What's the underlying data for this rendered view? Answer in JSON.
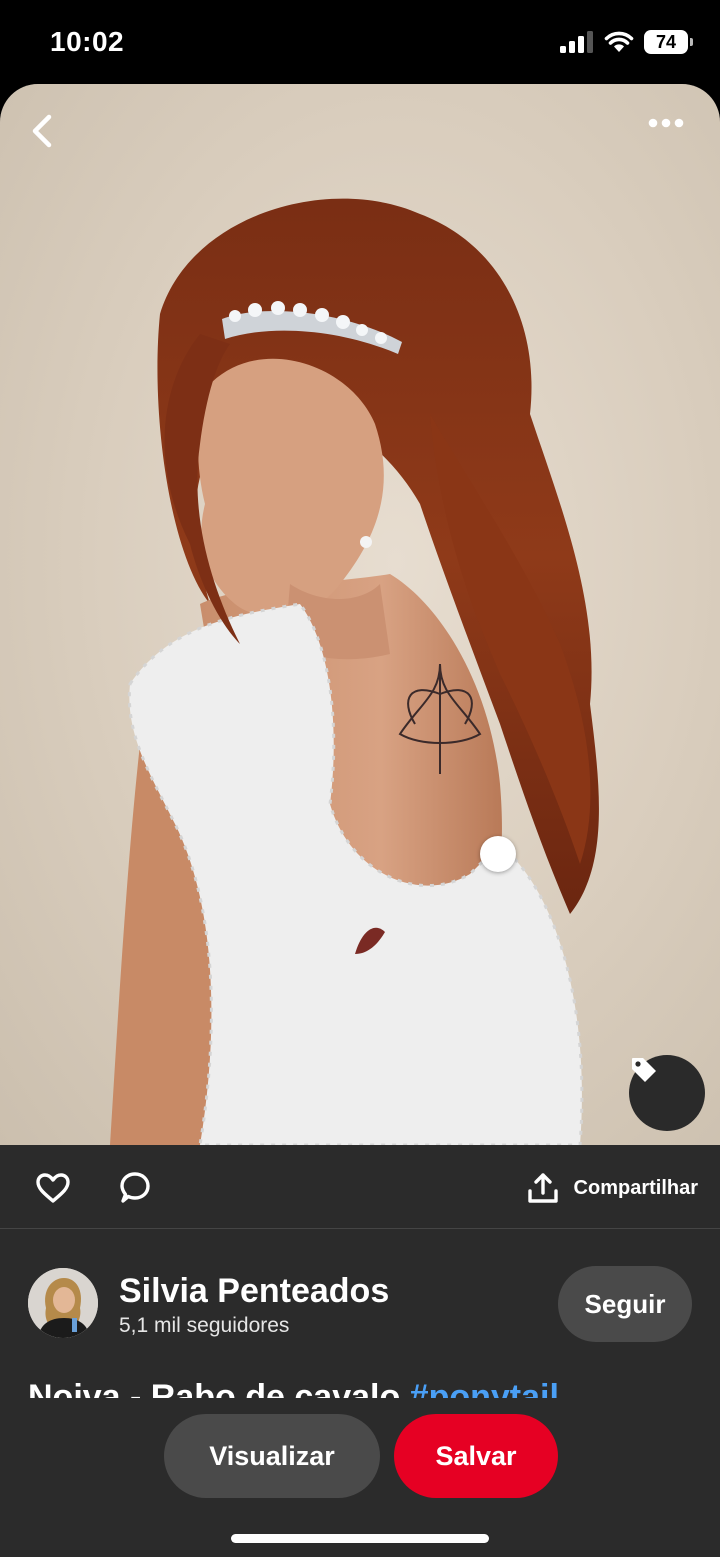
{
  "status_bar": {
    "time": "10:02",
    "battery": "74"
  },
  "pin": {
    "image_alt": "Noiva com vestido de renda e rabo de cavalo",
    "icons": {
      "back": "chevron-left-icon",
      "more": "more-horizontal-icon",
      "tag": "tag-icon"
    }
  },
  "actions": {
    "share_label": "Compartilhar",
    "icons": {
      "like": "heart-icon",
      "comment": "comment-icon",
      "share": "share-icon"
    }
  },
  "profile": {
    "name": "Silvia Penteados",
    "followers": "5,1 mil seguidores",
    "follow_label": "Seguir"
  },
  "description": {
    "text": "Noiva - Rabo de cavalo ",
    "hashtag": "#ponytail"
  },
  "bottom_bar": {
    "view_label": "Visualizar",
    "save_label": "Salvar"
  },
  "colors": {
    "save": "#e60023",
    "hashtag": "#4a9ff5",
    "panel": "#2b2b2b"
  }
}
